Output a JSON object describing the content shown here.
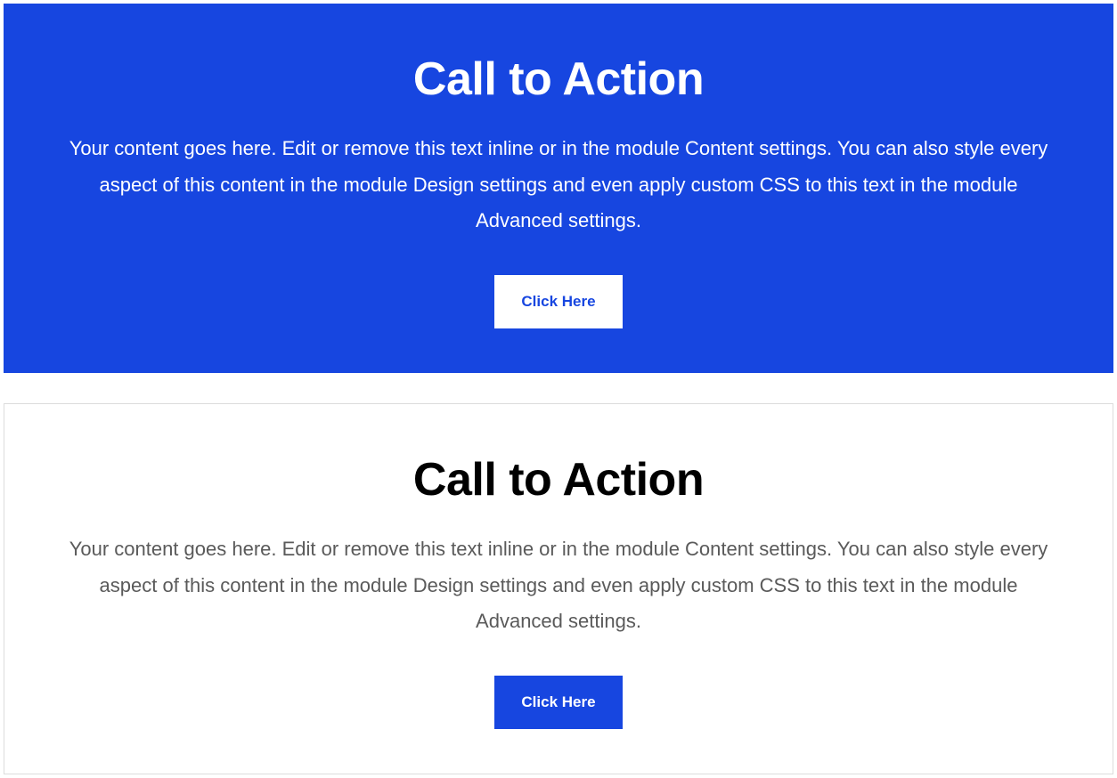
{
  "sections": [
    {
      "title": "Call to Action",
      "description": "Your content goes here. Edit or remove this text inline or in the module Content settings. You can also style every aspect of this content in the module Design settings and even apply custom CSS to this text in the module Advanced settings.",
      "button_label": "Click Here"
    },
    {
      "title": "Call to Action",
      "description": "Your content goes here. Edit or remove this text inline or in the module Content settings. You can also style every aspect of this content in the module Design settings and even apply custom CSS to this text in the module Advanced settings.",
      "button_label": "Click Here"
    }
  ],
  "colors": {
    "primary": "#1746e0",
    "white": "#ffffff",
    "border": "#dcdcdc",
    "text_muted": "#5a5a5a",
    "black": "#000000"
  }
}
